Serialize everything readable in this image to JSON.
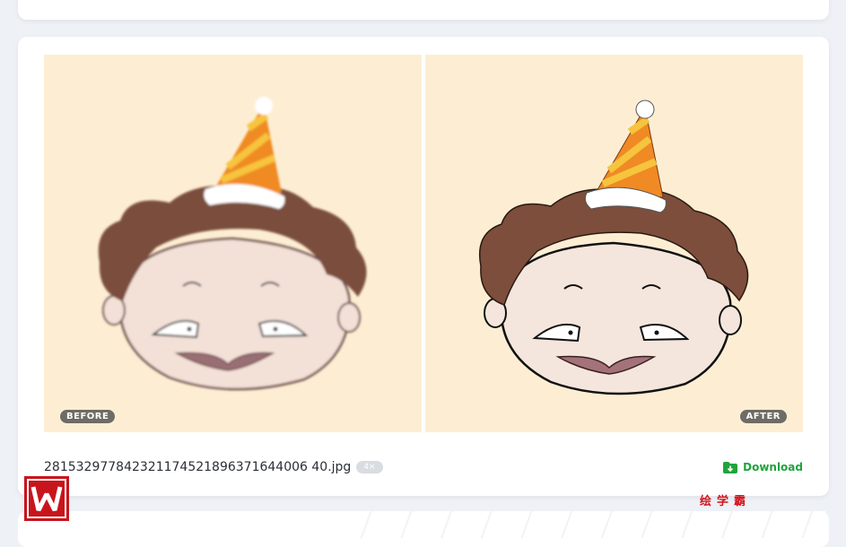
{
  "compare": {
    "before_label": "BEFORE",
    "after_label": "AFTER"
  },
  "file": {
    "name": "281532977842321174521896371644006 40.jpg",
    "scale_badge": "4×",
    "download_label": "Download"
  },
  "watermark": {
    "text": "绘学霸",
    "logo_letter": "W"
  },
  "colors": {
    "accent_green": "#22a33c",
    "panel_bg": "#fdeed3",
    "watermark_red": "#c8151c"
  },
  "icons": {
    "download": "folder-download-icon"
  }
}
